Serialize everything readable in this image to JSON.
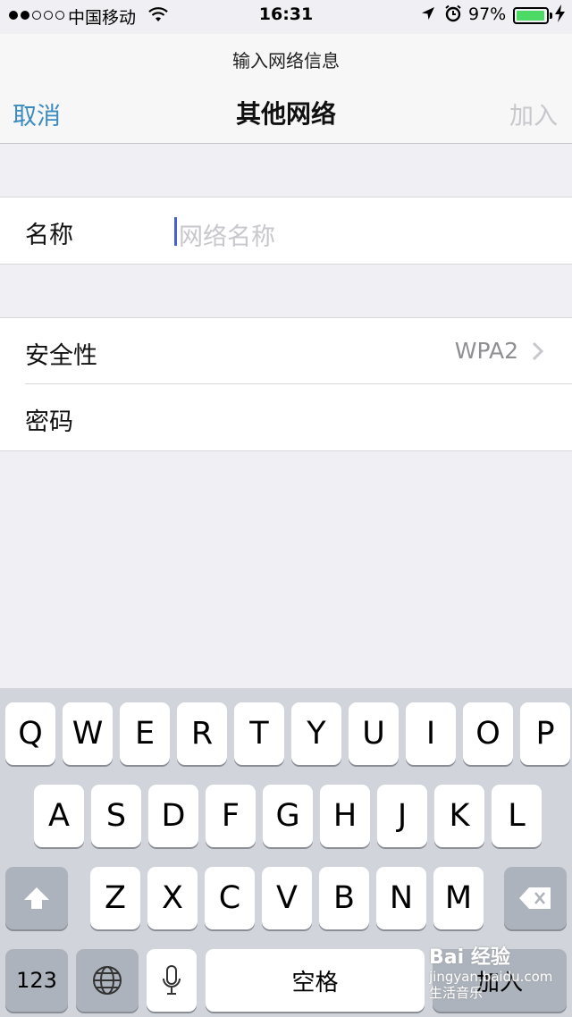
{
  "status_bar": {
    "carrier": "中国移动",
    "time": "16:31",
    "battery": "97%",
    "battery_level": 0.97,
    "icons": [
      "signal-dots",
      "wifi-icon",
      "location-arrow-icon",
      "alarm-icon",
      "battery-icon",
      "charging-bolt-icon"
    ]
  },
  "nav": {
    "prompt": "输入网络信息",
    "title": "其他网络",
    "cancel_label": "取消",
    "join_label": "加入"
  },
  "form": {
    "name_label": "名称",
    "name_placeholder": "网络名称",
    "security_label": "安全性",
    "security_value": "WPA2",
    "password_label": "密码"
  },
  "keyboard": {
    "row1": [
      "Q",
      "W",
      "E",
      "R",
      "T",
      "Y",
      "U",
      "I",
      "O",
      "P"
    ],
    "row2": [
      "A",
      "S",
      "D",
      "F",
      "G",
      "H",
      "J",
      "K",
      "L"
    ],
    "row3": [
      "Z",
      "X",
      "C",
      "V",
      "B",
      "N",
      "M"
    ],
    "numbers_label": "123",
    "space_label": "空格",
    "return_label": "加入",
    "icons": [
      "shift-icon",
      "delete-icon",
      "globe-icon",
      "microphone-icon"
    ]
  },
  "watermark": {
    "line1": "Bai 经验",
    "line2": "jingyan.baidu.com",
    "line3": "生活音乐"
  },
  "colors": {
    "accent": "#3a8bc1",
    "disabled": "#c7c7cc",
    "keyboard_bg": "#d1d5db",
    "battery_fill": "#4cd964"
  }
}
